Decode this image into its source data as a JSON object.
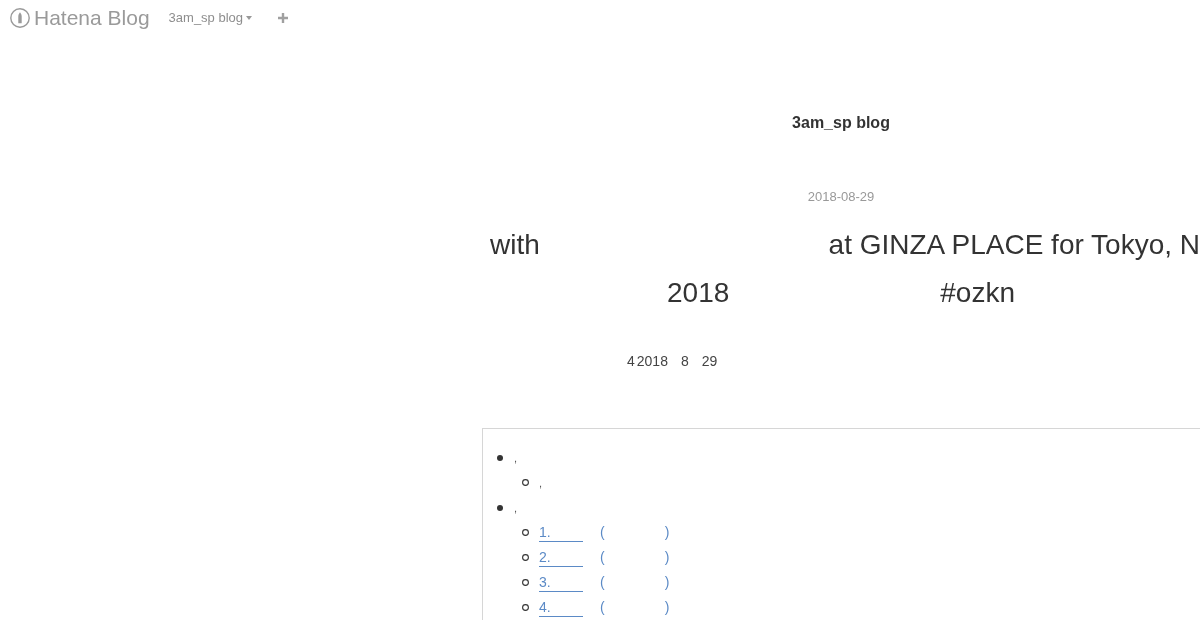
{
  "header": {
    "logo": "Hatena Blog",
    "blog_menu": "3am_sp blog"
  },
  "blog_title": "3am_sp blog",
  "entry": {
    "date": "2018-08-29",
    "title_lines": [
      [
        "with",
        "at GINZA PLACE for Tokyo, N"
      ],
      [
        "2018",
        "#ozkn"
      ]
    ],
    "meta": [
      "4",
      "2018",
      "8",
      "29"
    ]
  },
  "toc": {
    "items": [
      {
        "text": ",",
        "children": [
          {
            "kind": "text",
            "text": ","
          }
        ]
      },
      {
        "text": ",",
        "children": [
          {
            "kind": "link",
            "text": "1.",
            "open": "(",
            "close": ")"
          },
          {
            "kind": "link",
            "text": "2.",
            "open": "(",
            "close": ")"
          },
          {
            "kind": "link",
            "text": "3.",
            "open": "(",
            "close": ")"
          },
          {
            "kind": "link",
            "text": "4.",
            "open": "(",
            "close": ")"
          }
        ]
      }
    ]
  }
}
